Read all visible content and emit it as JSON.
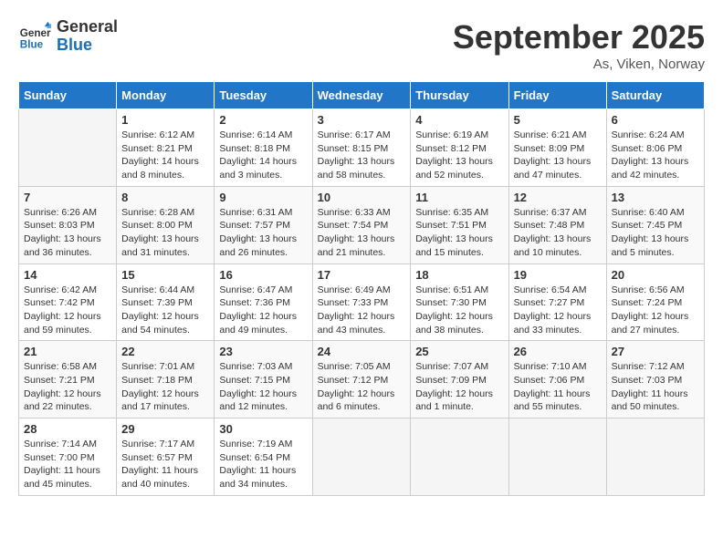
{
  "header": {
    "logo_line1": "General",
    "logo_line2": "Blue",
    "month": "September 2025",
    "location": "As, Viken, Norway"
  },
  "days_of_week": [
    "Sunday",
    "Monday",
    "Tuesday",
    "Wednesday",
    "Thursday",
    "Friday",
    "Saturday"
  ],
  "weeks": [
    [
      {
        "num": "",
        "info": ""
      },
      {
        "num": "1",
        "info": "Sunrise: 6:12 AM\nSunset: 8:21 PM\nDaylight: 14 hours\nand 8 minutes."
      },
      {
        "num": "2",
        "info": "Sunrise: 6:14 AM\nSunset: 8:18 PM\nDaylight: 14 hours\nand 3 minutes."
      },
      {
        "num": "3",
        "info": "Sunrise: 6:17 AM\nSunset: 8:15 PM\nDaylight: 13 hours\nand 58 minutes."
      },
      {
        "num": "4",
        "info": "Sunrise: 6:19 AM\nSunset: 8:12 PM\nDaylight: 13 hours\nand 52 minutes."
      },
      {
        "num": "5",
        "info": "Sunrise: 6:21 AM\nSunset: 8:09 PM\nDaylight: 13 hours\nand 47 minutes."
      },
      {
        "num": "6",
        "info": "Sunrise: 6:24 AM\nSunset: 8:06 PM\nDaylight: 13 hours\nand 42 minutes."
      }
    ],
    [
      {
        "num": "7",
        "info": "Sunrise: 6:26 AM\nSunset: 8:03 PM\nDaylight: 13 hours\nand 36 minutes."
      },
      {
        "num": "8",
        "info": "Sunrise: 6:28 AM\nSunset: 8:00 PM\nDaylight: 13 hours\nand 31 minutes."
      },
      {
        "num": "9",
        "info": "Sunrise: 6:31 AM\nSunset: 7:57 PM\nDaylight: 13 hours\nand 26 minutes."
      },
      {
        "num": "10",
        "info": "Sunrise: 6:33 AM\nSunset: 7:54 PM\nDaylight: 13 hours\nand 21 minutes."
      },
      {
        "num": "11",
        "info": "Sunrise: 6:35 AM\nSunset: 7:51 PM\nDaylight: 13 hours\nand 15 minutes."
      },
      {
        "num": "12",
        "info": "Sunrise: 6:37 AM\nSunset: 7:48 PM\nDaylight: 13 hours\nand 10 minutes."
      },
      {
        "num": "13",
        "info": "Sunrise: 6:40 AM\nSunset: 7:45 PM\nDaylight: 13 hours\nand 5 minutes."
      }
    ],
    [
      {
        "num": "14",
        "info": "Sunrise: 6:42 AM\nSunset: 7:42 PM\nDaylight: 12 hours\nand 59 minutes."
      },
      {
        "num": "15",
        "info": "Sunrise: 6:44 AM\nSunset: 7:39 PM\nDaylight: 12 hours\nand 54 minutes."
      },
      {
        "num": "16",
        "info": "Sunrise: 6:47 AM\nSunset: 7:36 PM\nDaylight: 12 hours\nand 49 minutes."
      },
      {
        "num": "17",
        "info": "Sunrise: 6:49 AM\nSunset: 7:33 PM\nDaylight: 12 hours\nand 43 minutes."
      },
      {
        "num": "18",
        "info": "Sunrise: 6:51 AM\nSunset: 7:30 PM\nDaylight: 12 hours\nand 38 minutes."
      },
      {
        "num": "19",
        "info": "Sunrise: 6:54 AM\nSunset: 7:27 PM\nDaylight: 12 hours\nand 33 minutes."
      },
      {
        "num": "20",
        "info": "Sunrise: 6:56 AM\nSunset: 7:24 PM\nDaylight: 12 hours\nand 27 minutes."
      }
    ],
    [
      {
        "num": "21",
        "info": "Sunrise: 6:58 AM\nSunset: 7:21 PM\nDaylight: 12 hours\nand 22 minutes."
      },
      {
        "num": "22",
        "info": "Sunrise: 7:01 AM\nSunset: 7:18 PM\nDaylight: 12 hours\nand 17 minutes."
      },
      {
        "num": "23",
        "info": "Sunrise: 7:03 AM\nSunset: 7:15 PM\nDaylight: 12 hours\nand 12 minutes."
      },
      {
        "num": "24",
        "info": "Sunrise: 7:05 AM\nSunset: 7:12 PM\nDaylight: 12 hours\nand 6 minutes."
      },
      {
        "num": "25",
        "info": "Sunrise: 7:07 AM\nSunset: 7:09 PM\nDaylight: 12 hours\nand 1 minute."
      },
      {
        "num": "26",
        "info": "Sunrise: 7:10 AM\nSunset: 7:06 PM\nDaylight: 11 hours\nand 55 minutes."
      },
      {
        "num": "27",
        "info": "Sunrise: 7:12 AM\nSunset: 7:03 PM\nDaylight: 11 hours\nand 50 minutes."
      }
    ],
    [
      {
        "num": "28",
        "info": "Sunrise: 7:14 AM\nSunset: 7:00 PM\nDaylight: 11 hours\nand 45 minutes."
      },
      {
        "num": "29",
        "info": "Sunrise: 7:17 AM\nSunset: 6:57 PM\nDaylight: 11 hours\nand 40 minutes."
      },
      {
        "num": "30",
        "info": "Sunrise: 7:19 AM\nSunset: 6:54 PM\nDaylight: 11 hours\nand 34 minutes."
      },
      {
        "num": "",
        "info": ""
      },
      {
        "num": "",
        "info": ""
      },
      {
        "num": "",
        "info": ""
      },
      {
        "num": "",
        "info": ""
      }
    ]
  ]
}
